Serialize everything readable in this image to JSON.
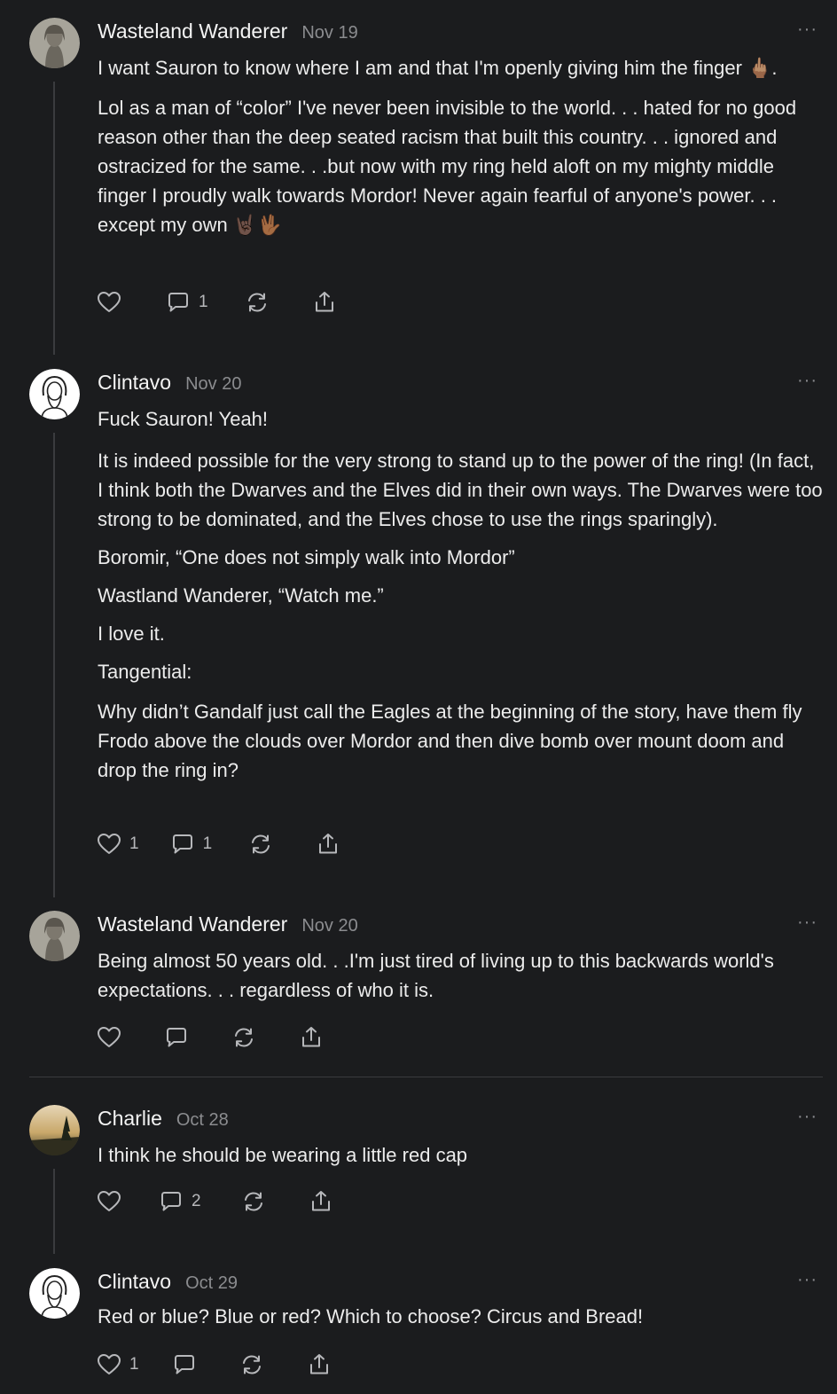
{
  "comments": [
    {
      "author": "Wasteland Wanderer",
      "date": "Nov 19",
      "more": "···",
      "paragraphs": [
        "I want Sauron to know where I am and that I'm openly giving him the finger 🖕🏽.",
        "Lol as a man of “color” I've never been invisible to the world. . . hated for no good reason other than the deep seated racism that built this country. . . ignored and ostracized for the same. . .but now with my ring held aloft on my mighty middle finger I proudly walk towards Mordor! Never again fearful of anyone's power. . . except my own 🤘🏿🖖🏾"
      ],
      "likes": "",
      "replies": "1"
    },
    {
      "author": "Clintavo",
      "date": "Nov 20",
      "more": "···",
      "paragraphs": [
        "Fuck Sauron! Yeah!",
        "It is indeed possible for the very strong to stand up to the power of the ring! (In fact, I think both the Dwarves and the Elves did in their own ways. The Dwarves were too strong to be dominated, and the Elves chose to use the rings sparingly).",
        "Boromir, “One does not simply walk into Mordor”",
        "Wastland Wanderer, “Watch me.”",
        "I love it.",
        "Tangential:",
        "Why didn’t Gandalf just call the Eagles at the beginning of the story, have them fly Frodo above the clouds over Mordor and then dive bomb over mount doom and drop the ring in?"
      ],
      "likes": "1",
      "replies": "1"
    },
    {
      "author": "Wasteland Wanderer",
      "date": "Nov 20",
      "more": "···",
      "paragraphs": [
        "Being almost 50 years old. . .I'm just tired of living up to this backwards world's expectations. . . regardless of who it is."
      ],
      "likes": "",
      "replies": ""
    },
    {
      "author": "Charlie",
      "date": "Oct 28",
      "more": "···",
      "paragraphs": [
        "I think he should be wearing a little red cap"
      ],
      "likes": "",
      "replies": "2"
    },
    {
      "author": "Clintavo",
      "date": "Oct 29",
      "more": "···",
      "paragraphs": [
        "Red or blue? Blue or red? Which to choose? Circus and Bread!"
      ],
      "likes": "1",
      "replies": ""
    }
  ],
  "icons": {
    "like": "heart-icon",
    "reply": "comment-icon",
    "restack": "restack-icon",
    "share": "share-icon",
    "more": "more-icon"
  },
  "colors": {
    "background": "#1b1c1e",
    "text": "#ececec",
    "muted": "#8b8c8f",
    "line": "#3a3b3e"
  }
}
